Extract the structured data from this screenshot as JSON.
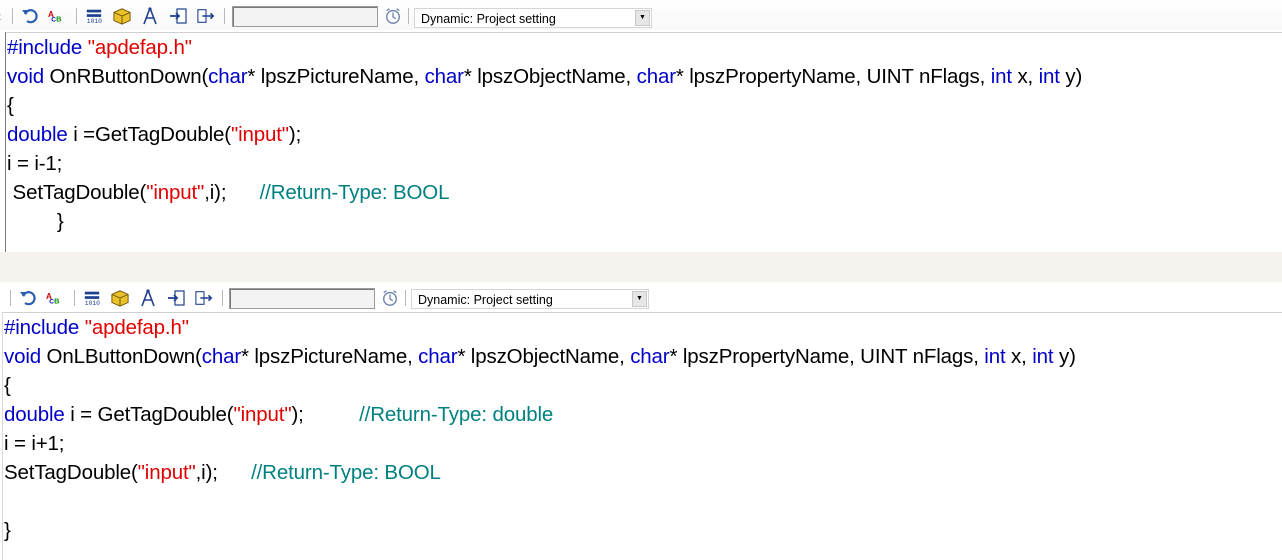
{
  "colors": {
    "keyword": "#0000c8",
    "string": "#e00000",
    "comment": "#008080",
    "text": "#000000",
    "band": "#f6f2ee"
  },
  "icons": [
    "undo-icon",
    "abc-replace-icon",
    "tag-counter-icon",
    "cube-icon",
    "compass-icon",
    "import-icon",
    "export-icon",
    "clock-icon",
    "dropdown-arrow-icon"
  ],
  "top_panel": {
    "trigger_label": "Dynamic: Project setting",
    "code": {
      "include_kw": "#include",
      "include_file": "\"apdefap.h\"",
      "sig_void": "void",
      "sig_fn": " OnRButtonDown(",
      "sig_char1": "char",
      "sig_p1": "* lpszPictureName, ",
      "sig_char2": "char",
      "sig_p2": "* lpszObjectName, ",
      "sig_char3": "char",
      "sig_p3": "* lpszPropertyName, UINT nFlags, ",
      "sig_int1": "int",
      "sig_p4": " x, ",
      "sig_int2": "int",
      "sig_p5": " y)",
      "open_brace": "{",
      "l1_type": "double",
      "l1_text": " i =GetTagDouble(",
      "l1_str": "\"input\"",
      "l1_end": ");",
      "l2_text": "i = i-1;",
      "l3_text": " SetTagDouble(",
      "l3_str": "\"input\"",
      "l3_end": ",i);      ",
      "l3_cmt": "//Return-Type: BOOL",
      "close_brace": "         }"
    }
  },
  "bottom_panel": {
    "trigger_label": "Dynamic: Project setting",
    "code": {
      "include_kw": "#include",
      "include_file": "\"apdefap.h\"",
      "sig_void": "void",
      "sig_fn": " OnLButtonDown(",
      "sig_char1": "char",
      "sig_p1": "* lpszPictureName, ",
      "sig_char2": "char",
      "sig_p2": "* lpszObjectName, ",
      "sig_char3": "char",
      "sig_p3": "* lpszPropertyName, UINT nFlags, ",
      "sig_int1": "int",
      "sig_p4": " x, ",
      "sig_int2": "int",
      "sig_p5": " y)",
      "open_brace": "{",
      "l1_type": "double",
      "l1_text": " i = GetTagDouble(",
      "l1_str": "\"input\"",
      "l1_end": ");          ",
      "l1_cmt": "//Return-Type: double",
      "l2_text": "i = i+1;",
      "l3_text": "SetTagDouble(",
      "l3_str": "\"input\"",
      "l3_end": ",i);      ",
      "l3_cmt": "//Return-Type: BOOL",
      "close_brace": "}"
    }
  }
}
